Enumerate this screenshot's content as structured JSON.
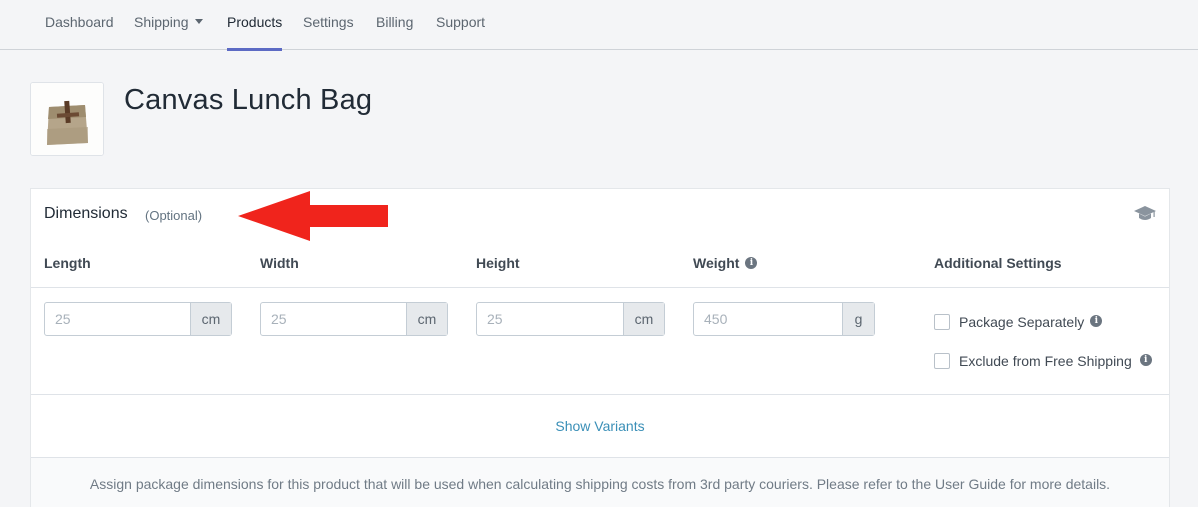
{
  "nav": {
    "items": [
      {
        "label": "Dashboard"
      },
      {
        "label": "Shipping"
      },
      {
        "label": "Products"
      },
      {
        "label": "Settings"
      },
      {
        "label": "Billing"
      },
      {
        "label": "Support"
      }
    ],
    "active": "Products",
    "accent_color": "#5c6ac4"
  },
  "product": {
    "title": "Canvas Lunch Bag",
    "thumbnail_icon": "lunch-bag-image"
  },
  "dimensions": {
    "title": "Dimensions",
    "optional_label": "(Optional)",
    "help_icon": "graduation-cap-icon",
    "columns": {
      "length": "Length",
      "width": "Width",
      "height": "Height",
      "weight": "Weight",
      "additional": "Additional Settings"
    },
    "fields": {
      "length": {
        "placeholder": "25",
        "unit": "cm"
      },
      "width": {
        "placeholder": "25",
        "unit": "cm"
      },
      "height": {
        "placeholder": "25",
        "unit": "cm"
      },
      "weight": {
        "placeholder": "450",
        "unit": "g"
      }
    },
    "options": {
      "package_separately": "Package Separately",
      "exclude_free_shipping": "Exclude from Free Shipping"
    },
    "show_variants": "Show Variants",
    "footer": "Assign package dimensions for this product that will be used when calculating shipping costs from 3rd party couriers. Please refer to the User Guide for more details."
  },
  "annotation": {
    "arrow_color": "#f0241c"
  }
}
